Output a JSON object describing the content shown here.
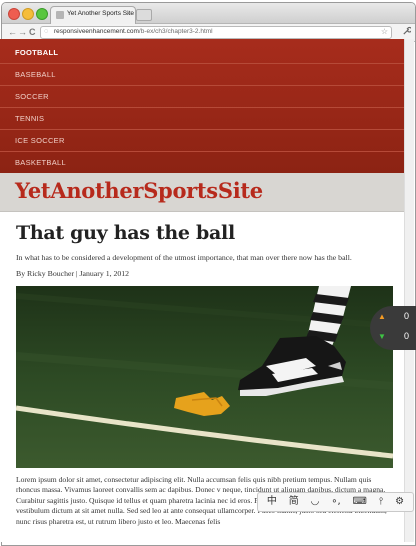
{
  "browser": {
    "tab_title": "Yet Another Sports Site",
    "tab_close": "×",
    "url_prefix": "responsiveenhancement.com",
    "url_path": "/b-ex/ch3/chapter3-2.html",
    "nav_back": "←",
    "nav_forward": "→",
    "nav_reload": "C",
    "star": "☆",
    "wrench": "🔧"
  },
  "site": {
    "nav": [
      "FOOTBALL",
      "BASEBALL",
      "SOCCER",
      "TENNIS",
      "ICE SOCCER",
      "BASKETBALL"
    ],
    "active_nav": "FOOTBALL",
    "logo": "YetAnotherSportsSite"
  },
  "article": {
    "headline": "That guy has the ball",
    "dek": "In what has to be considered a development of the utmost importance, that man over there now has the ball.",
    "byline": "By Ricky Boucher | January 1, 2012",
    "body_lines": [
      "Lorem ipsum dolor sit amet, consectetur adipiscing elit. Nulla accumsan felis quis nibh pretium tempus. Nullam",
      "quis rhoncus massa. Vivamus laoreet convallis sem ac dapibus. Donec v",
      "neque, tincidunt ut aliquam dapibus, dictum a magna. Curabitur sagittis",
      "justo. Quisque id tellus et quam pharetra lacinia nec id eros. Praesent fe",
      "Suspendisse eu ante sed est vestibulum dictum at sit amet nulla. Sed sed leo at ante consequat ullamcorper.",
      "Fusce mattis, justo sed eleifend bibendum, nunc risus pharetra est, ut rutrum libero justo et leo. Maecenas felis"
    ]
  },
  "side_widget": {
    "up_value": "0",
    "down_value": "0"
  },
  "ime": {
    "items": [
      "中",
      "简",
      "◡",
      "∘,",
      "⌨",
      "⫯",
      "⚙"
    ]
  },
  "colors": {
    "nav_red": "#8c2313",
    "logo_red": "#b72a1c",
    "masthead": "#d8d6d2"
  }
}
